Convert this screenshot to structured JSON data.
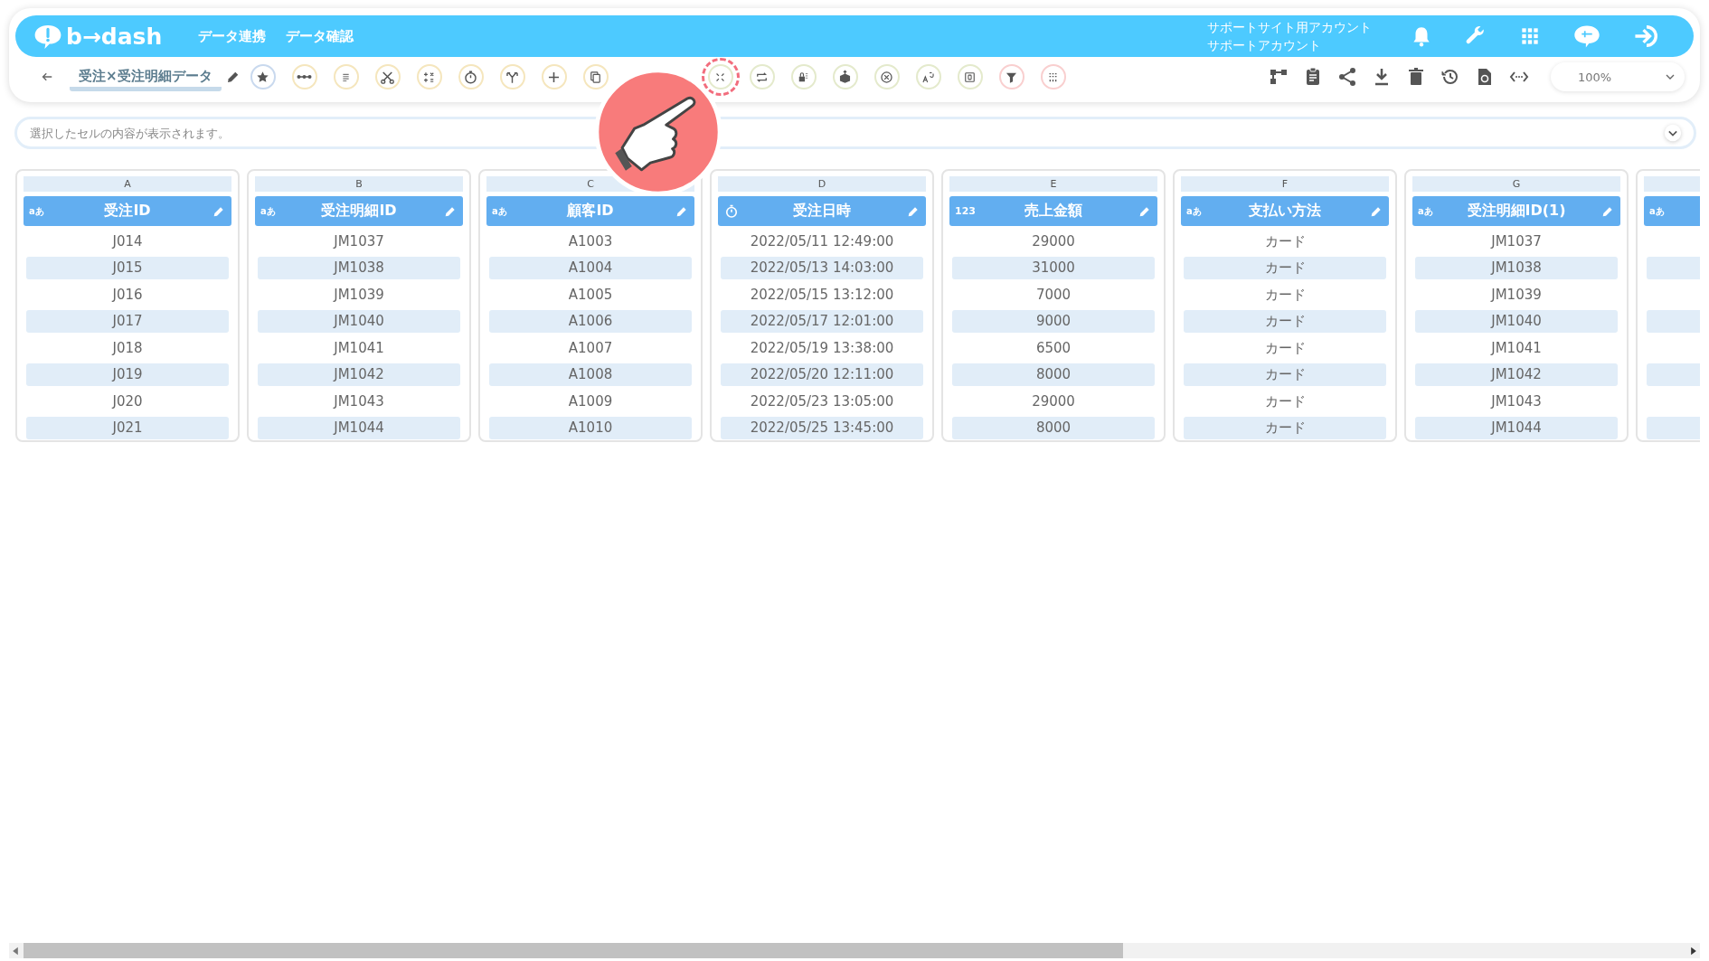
{
  "header": {
    "logo": "b→dash",
    "nav": [
      {
        "label": "データ連携"
      },
      {
        "label": "データ確認"
      }
    ],
    "account": {
      "line_1": "サポートサイト用アカウント",
      "line_2": "サポートアカウント"
    }
  },
  "toolbar": {
    "title": "受注×受注明細データ",
    "tools": [
      {
        "color": "#c9d9ee",
        "highlighted": false
      },
      {
        "color": "#f5e6bd",
        "highlighted": false
      },
      {
        "color": "#f5e6bd",
        "highlighted": false
      },
      {
        "color": "#f5e6bd",
        "highlighted": false
      },
      {
        "color": "#f5e6bd",
        "highlighted": false
      },
      {
        "color": "#f5e6bd",
        "highlighted": false
      },
      {
        "color": "#f5e6bd",
        "highlighted": false
      },
      {
        "color": "#f5e6bd",
        "highlighted": false
      },
      {
        "color": "#f5e6bd",
        "highlighted": false
      },
      {
        "color": "#e4eacc",
        "highlighted": true
      },
      {
        "color": "#e4eacc",
        "highlighted": false
      },
      {
        "color": "#e4eacc",
        "highlighted": false
      },
      {
        "color": "#e4eacc",
        "highlighted": false
      },
      {
        "color": "#e4eacc",
        "highlighted": false
      },
      {
        "color": "#e4eacc",
        "highlighted": false
      },
      {
        "color": "#e4eacc",
        "highlighted": false
      },
      {
        "color": "#f9cfcf",
        "highlighted": false
      },
      {
        "color": "#f9cfcf",
        "highlighted": false
      }
    ],
    "zoom": "100%"
  },
  "formula_bar": {
    "placeholder": "選択したセルの内容が表示されます。"
  },
  "columns": [
    {
      "letter": "A",
      "kind": "text",
      "type_label": "aあ",
      "title": "受注ID",
      "cells": [
        "J014",
        "J015",
        "J016",
        "J017",
        "J018",
        "J019",
        "J020",
        "J021"
      ]
    },
    {
      "letter": "B",
      "kind": "text",
      "type_label": "aあ",
      "title": "受注明細ID",
      "cells": [
        "JM1037",
        "JM1038",
        "JM1039",
        "JM1040",
        "JM1041",
        "JM1042",
        "JM1043",
        "JM1044"
      ]
    },
    {
      "letter": "C",
      "kind": "text",
      "type_label": "aあ",
      "title": "顧客ID",
      "cells": [
        "A1003",
        "A1004",
        "A1005",
        "A1006",
        "A1007",
        "A1008",
        "A1009",
        "A1010"
      ]
    },
    {
      "letter": "D",
      "kind": "datetime",
      "title": "受注日時",
      "cells": [
        "2022/05/11 12:49:00",
        "2022/05/13 14:03:00",
        "2022/05/15 13:12:00",
        "2022/05/17 12:01:00",
        "2022/05/19 13:38:00",
        "2022/05/20 12:11:00",
        "2022/05/23 13:05:00",
        "2022/05/25 13:45:00"
      ]
    },
    {
      "letter": "E",
      "kind": "number",
      "type_label": "123",
      "title": "売上金額",
      "cells": [
        "29000",
        "31000",
        "7000",
        "9000",
        "6500",
        "8000",
        "29000",
        "8000"
      ]
    },
    {
      "letter": "F",
      "kind": "text",
      "type_label": "aあ",
      "title": "支払い方法",
      "cells": [
        "カード",
        "カード",
        "カード",
        "カード",
        "カード",
        "カード",
        "カード",
        "カード"
      ]
    },
    {
      "letter": "G",
      "kind": "text",
      "type_label": "aあ",
      "title": "受注明細ID(1)",
      "cells": [
        "JM1037",
        "JM1038",
        "JM1039",
        "JM1040",
        "JM1041",
        "JM1042",
        "JM1043",
        "JM1044"
      ]
    },
    {
      "kind": "text",
      "type_label": "aあ"
    }
  ]
}
